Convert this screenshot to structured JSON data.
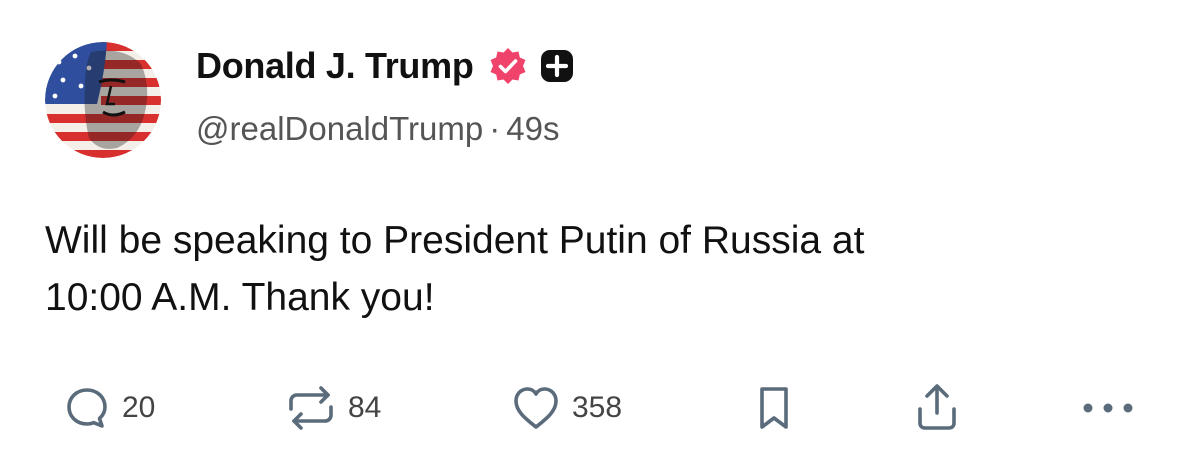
{
  "post": {
    "author": {
      "display_name": "Donald J. Trump",
      "handle": "@realDonaldTrump",
      "separator": "·",
      "time_ago": "49s",
      "avatar_icon": "flag-portrait-avatar",
      "verified_icon": "verified-badge-icon",
      "verified_color": "#f0436b",
      "plus_icon": "plus-badge-icon"
    },
    "text_line_1": "Will be speaking to President Putin of Russia at",
    "text_line_2": "10:00 A.M. Thank you!",
    "actions": {
      "replies": "20",
      "reposts": "84",
      "likes": "358",
      "icon_color": "#5a6b7b"
    }
  }
}
